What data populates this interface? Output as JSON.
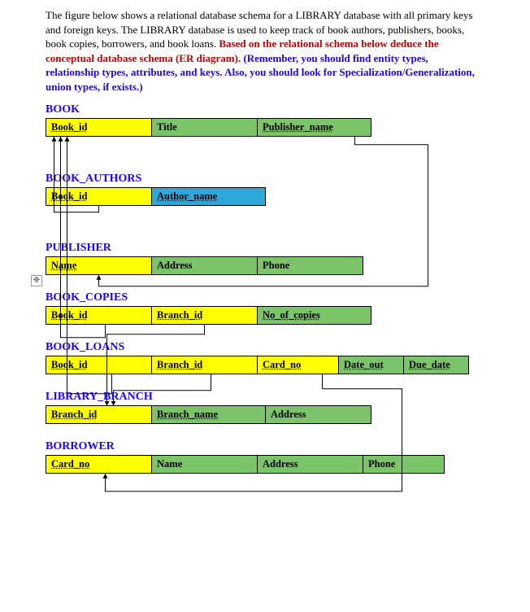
{
  "intro": {
    "p1": "The figure below shows a relational database schema for a LIBRARY database with all primary keys and foreign keys. The LIBRARY database is used to keep track of book authors, publishers, books, book copies, borrowers, and book loans. ",
    "red": "Based on the relational schema below deduce the conceptual database schema (ER diagram). ",
    "blue": "(Remember, you should find entity types, relationship types, attributes, and keys. Also, you should look for Specialization/Generalization, union types, if exists.)"
  },
  "marker": "✥",
  "tables": {
    "book": {
      "title": "BOOK",
      "cols": [
        {
          "label": "Book_id",
          "cls": "pk w-130"
        },
        {
          "label": "Title",
          "cls": "attr w-130"
        },
        {
          "label": "Publisher_name",
          "cls": "attr-u w-140"
        }
      ]
    },
    "book_authors": {
      "title": "BOOK_AUTHORS",
      "cols": [
        {
          "label": "Book_id",
          "cls": "pk w-130"
        },
        {
          "label": "Author_name",
          "cls": "fk-blue w-140"
        }
      ]
    },
    "publisher": {
      "title": "PUBLISHER",
      "cols": [
        {
          "label": "Name",
          "cls": "pk w-130"
        },
        {
          "label": "Address",
          "cls": "attr w-130"
        },
        {
          "label": "Phone",
          "cls": "attr w-130"
        }
      ]
    },
    "book_copies": {
      "title": "BOOK_COPIES",
      "cols": [
        {
          "label": "Book_id",
          "cls": "pk w-130"
        },
        {
          "label": "Branch_id",
          "cls": "pk w-130"
        },
        {
          "label": "No_of_copies",
          "cls": "attr-u w-140"
        }
      ]
    },
    "book_loans": {
      "title": "BOOK_LOANS",
      "cols": [
        {
          "label": "Book_id",
          "cls": "pk w-130"
        },
        {
          "label": "Branch_id",
          "cls": "pk w-130"
        },
        {
          "label": "Card_no",
          "cls": "pk w-100"
        },
        {
          "label": "Date_out",
          "cls": "attr-u w-80"
        },
        {
          "label": "Due_date",
          "cls": "attr-u w-80"
        }
      ]
    },
    "library_branch": {
      "title": "LIBRARY_BRANCH",
      "cols": [
        {
          "label": "Branch_id",
          "cls": "pk w-130"
        },
        {
          "label": "Branch_name",
          "cls": "attr-u w-140"
        },
        {
          "label": "Address",
          "cls": "attr w-130"
        }
      ]
    },
    "borrower": {
      "title": "BORROWER",
      "cols": [
        {
          "label": "Card_no",
          "cls": "pk w-130"
        },
        {
          "label": "Name",
          "cls": "attr w-130"
        },
        {
          "label": "Address",
          "cls": "attr w-130"
        },
        {
          "label": "Phone",
          "cls": "attr w-100"
        }
      ]
    }
  },
  "arrows": [
    {
      "from": "book_authors.0",
      "to": "book.0",
      "offset": 0
    },
    {
      "from": "book_copies.0",
      "to": "book.0",
      "offset": 8
    },
    {
      "from": "book_loans.0",
      "to": "book.0",
      "offset": 16
    },
    {
      "from": "book.2",
      "to": "publisher.0",
      "side": "right",
      "offset": 0
    },
    {
      "from": "book_copies.1",
      "to": "library_branch.0",
      "side": "under",
      "offset": 0
    },
    {
      "from": "book_loans.1",
      "to": "library_branch.0",
      "side": "under",
      "offset": 8
    },
    {
      "from": "book_loans.2",
      "to": "borrower.0",
      "side": "right",
      "offset": 8
    }
  ]
}
